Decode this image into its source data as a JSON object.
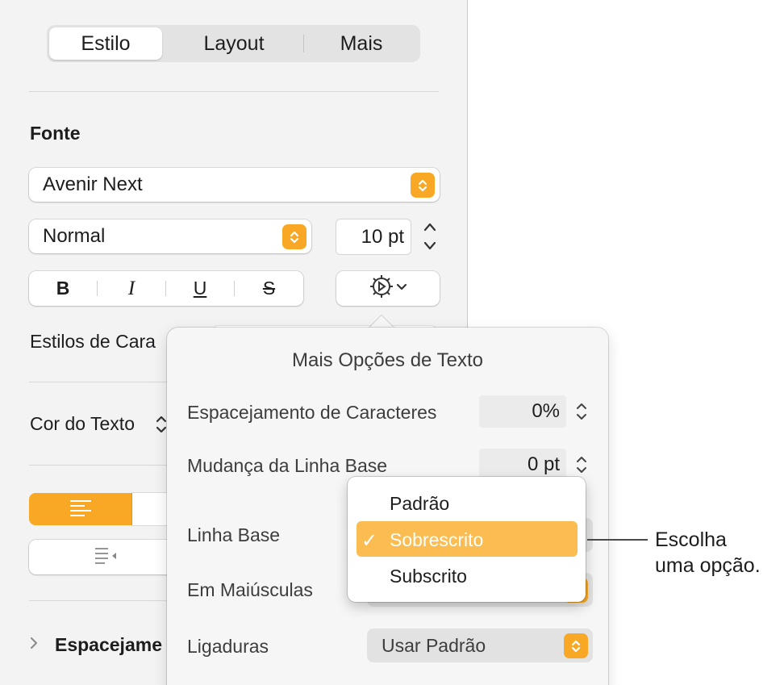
{
  "tabs": [
    {
      "label": "Estilo",
      "selected": true
    },
    {
      "label": "Layout",
      "selected": false
    },
    {
      "label": "Mais",
      "selected": false
    }
  ],
  "font": {
    "heading": "Fonte",
    "family": "Avenir Next",
    "typeface": "Normal",
    "size": "10 pt"
  },
  "style_buttons": {
    "bold": "B",
    "italic": "I",
    "underline": "U",
    "strike": "S"
  },
  "character_styles_label": "Estilos de Cara",
  "text_color_label": "Cor do Texto",
  "spacing_section_label": "Espacejame",
  "popover": {
    "title": "Mais Opções de Texto",
    "character_spacing": {
      "label": "Espacejamento de Caracteres",
      "value": "0%"
    },
    "baseline_shift": {
      "label": "Mudança da Linha Base",
      "value": "0 pt"
    },
    "baseline_label": "Linha Base",
    "capitalization_label": "Em Maiúsculas",
    "ligatures": {
      "label": "Ligaduras",
      "value": "Usar Padrão"
    }
  },
  "baseline_menu": {
    "options": [
      "Padrão",
      "Sobrescrito",
      "Subscrito"
    ],
    "selected": "Sobrescrito"
  },
  "callout": {
    "line1": "Escolha",
    "line2": "uma opção."
  },
  "colors": {
    "accent": "#f9a825",
    "highlight": "#fbbd52",
    "sidebar": "#f3f3f3"
  }
}
